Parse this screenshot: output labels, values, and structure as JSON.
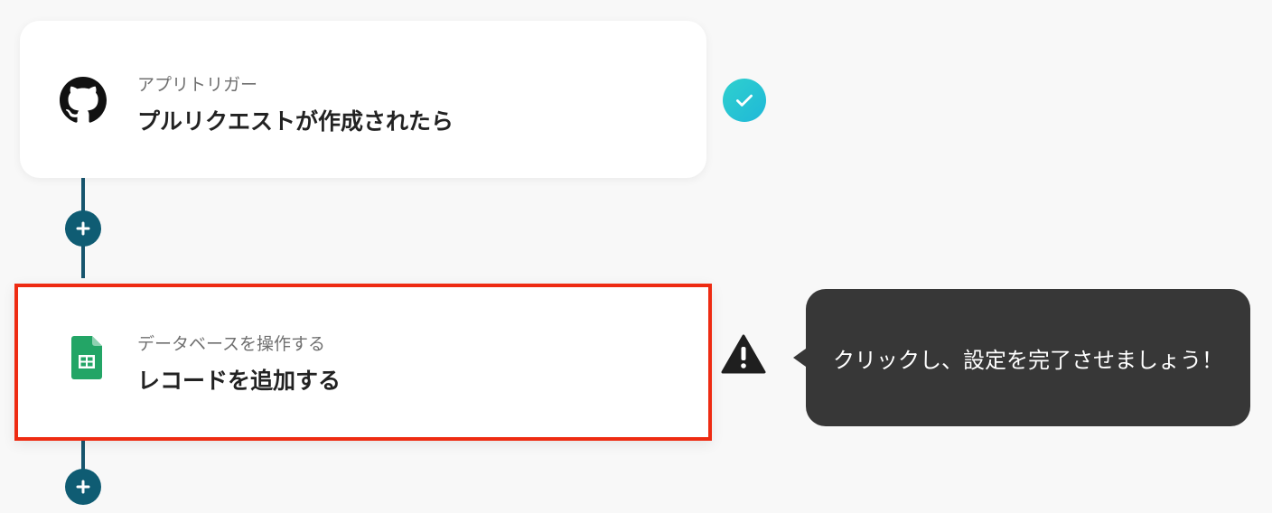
{
  "flow": {
    "trigger": {
      "subtitle": "アプリトリガー",
      "title": "プルリクエストが作成されたら",
      "icon": "github-icon",
      "status": "completed",
      "status_color": "#2fd0ce"
    },
    "action": {
      "subtitle": "データベースを操作する",
      "title": "レコードを追加する",
      "icon": "google-sheets-icon",
      "status": "warning",
      "highlight_color": "#ee2b12"
    },
    "add_step_color": "#0f5c73",
    "tooltip": {
      "text": "クリックし、設定を完了させましょう！"
    }
  }
}
